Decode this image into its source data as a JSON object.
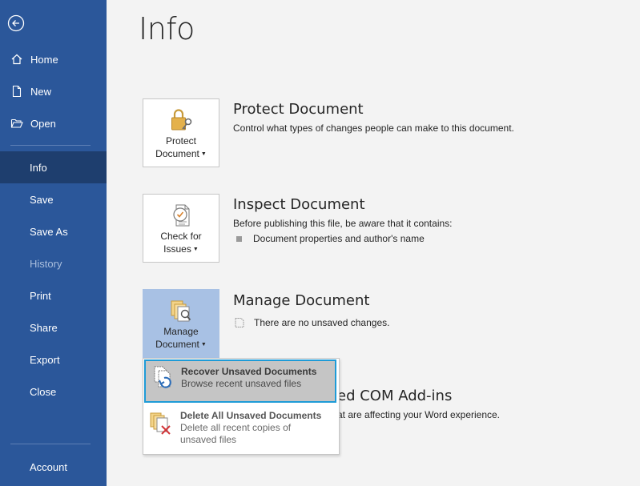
{
  "sidebar": {
    "items": [
      {
        "key": "home",
        "label": "Home"
      },
      {
        "key": "new",
        "label": "New"
      },
      {
        "key": "open",
        "label": "Open"
      },
      {
        "key": "info",
        "label": "Info"
      },
      {
        "key": "save",
        "label": "Save"
      },
      {
        "key": "save_as",
        "label": "Save As"
      },
      {
        "key": "history",
        "label": "History"
      },
      {
        "key": "print",
        "label": "Print"
      },
      {
        "key": "share",
        "label": "Share"
      },
      {
        "key": "export",
        "label": "Export"
      },
      {
        "key": "close",
        "label": "Close"
      },
      {
        "key": "account",
        "label": "Account"
      }
    ],
    "active": "Info",
    "disabled": "History"
  },
  "main": {
    "title": "Info",
    "protect": {
      "button_line1": "Protect",
      "button_line2": "Document",
      "heading": "Protect Document",
      "description": "Control what types of changes people can make to this document."
    },
    "inspect": {
      "button_line1": "Check for",
      "button_line2": "Issues",
      "heading": "Inspect Document",
      "description": "Before publishing this file, be aware that it contains:",
      "bullet": "Document properties and author's name"
    },
    "manage": {
      "button_line1": "Manage",
      "button_line2": "Document",
      "heading": "Manage Document",
      "status": "There are no unsaved changes."
    },
    "addins_partial": {
      "heading": "ed COM Add-ins",
      "description": "at are affecting your Word experience."
    }
  },
  "dropdown": {
    "recover": {
      "title": "Recover Unsaved Documents",
      "subtitle": "Browse recent unsaved files"
    },
    "delete": {
      "title": "Delete All Unsaved Documents",
      "subtitle_line1": "Delete all recent copies of",
      "subtitle_line2": "unsaved files"
    }
  },
  "colors": {
    "sidebar": "#2b579a",
    "active": "#1e3e6e",
    "highlight_border": "#1e9bd7",
    "tile_selected": "#a8c1e4"
  },
  "icons": [
    "back-arrow-icon",
    "home-icon",
    "new-doc-icon",
    "open-folder-icon",
    "lock-icon",
    "check-doc-icon",
    "manage-doc-icon",
    "recover-icon",
    "delete-docs-icon"
  ]
}
